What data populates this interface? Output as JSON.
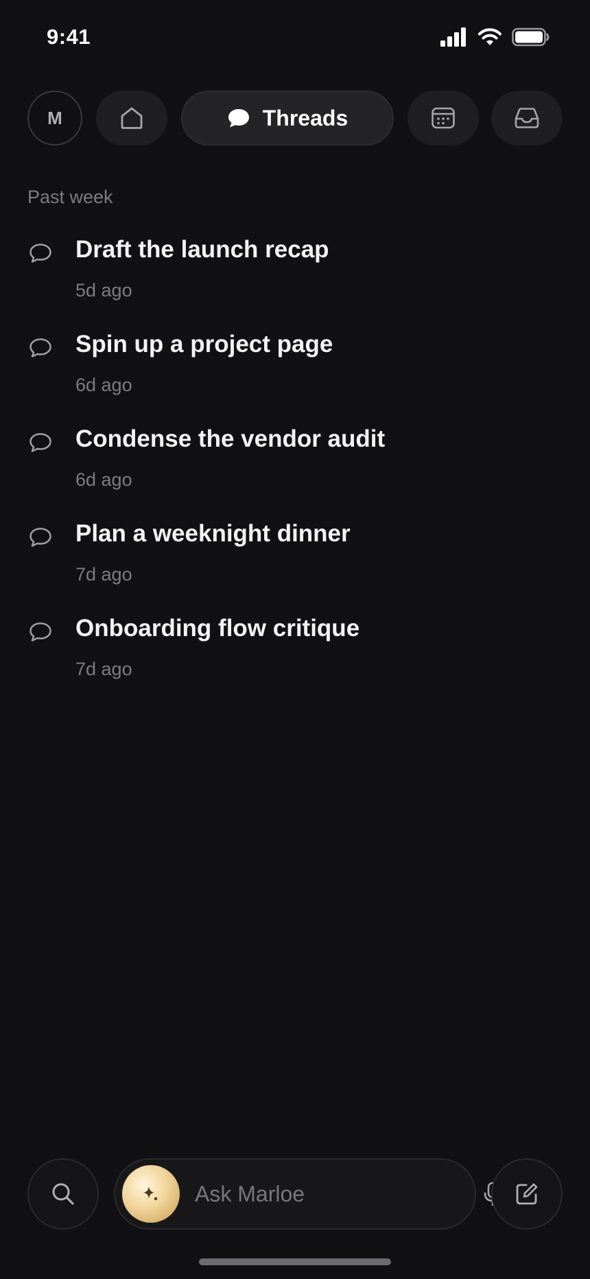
{
  "status_bar": {
    "time": "9:41"
  },
  "nav": {
    "avatar_initial": "M",
    "active_tab_label": "Threads",
    "icons": [
      "home-icon",
      "chat-bubble-icon",
      "calendar-icon",
      "inbox-icon"
    ]
  },
  "section": {
    "label": "Past week"
  },
  "threads": [
    {
      "title": "Draft the launch recap",
      "time": "5d ago"
    },
    {
      "title": "Spin up a project page",
      "time": "6d ago"
    },
    {
      "title": "Condense the vendor audit",
      "time": "6d ago"
    },
    {
      "title": "Plan a weeknight dinner",
      "time": "7d ago"
    },
    {
      "title": "Onboarding flow critique",
      "time": "7d ago"
    }
  ],
  "bottom_bar": {
    "ask_placeholder": "Ask Marloe",
    "icons": [
      "search-icon",
      "sparkle-icon",
      "microphone-icon",
      "compose-icon"
    ]
  },
  "colors": {
    "background": "#111113",
    "surface": "#1f1f22",
    "text_primary": "#f3f3f5",
    "text_secondary": "#7c7c82",
    "accent_gold": "#e8c887"
  }
}
